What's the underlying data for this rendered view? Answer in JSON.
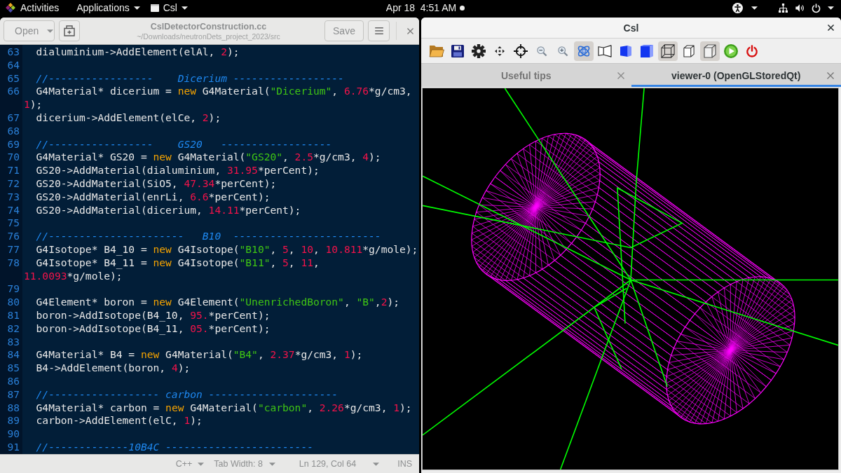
{
  "top_bar": {
    "activities": "Activities",
    "applications": "Applications",
    "app_menu": "Csl",
    "clock": "Apr 18  4:51 AM",
    "notification": true
  },
  "editor": {
    "open_button": "Open",
    "title": "CslDetectorConstruction.cc",
    "subtitle": "~/Downloads/neutronDets_project_2023/src",
    "save_button": "Save",
    "lines": [
      {
        "number": "63",
        "tokens": [
          {
            "kind": "plain",
            "text": "  dialuminium->AddElement(elAl, "
          },
          {
            "kind": "number",
            "text": "2"
          },
          {
            "kind": "plain",
            "text": ");"
          }
        ]
      },
      {
        "number": "64"
      },
      {
        "number": "65",
        "tokens": [
          {
            "kind": "comment",
            "text": "  //-----------------    Dicerium ------------------"
          }
        ]
      },
      {
        "number": "66",
        "tokens": [
          {
            "kind": "plain",
            "text": "  G4Material* dicerium = "
          },
          {
            "kind": "keyword",
            "text": "new"
          },
          {
            "kind": "plain",
            "text": " G4Material("
          },
          {
            "kind": "string",
            "text": "\"Dicerium\""
          },
          {
            "kind": "plain",
            "text": ", "
          },
          {
            "kind": "number",
            "text": "6.76"
          },
          {
            "kind": "plain",
            "text": "*g/cm3, "
          },
          {
            "kind": "number",
            "text": "1"
          },
          {
            "kind": "plain",
            "text": ");"
          }
        ]
      },
      {
        "number": "67",
        "tokens": [
          {
            "kind": "plain",
            "text": "  dicerium->AddElement(elCe, "
          },
          {
            "kind": "number",
            "text": "2"
          },
          {
            "kind": "plain",
            "text": ");"
          }
        ]
      },
      {
        "number": "68"
      },
      {
        "number": "69",
        "tokens": [
          {
            "kind": "comment",
            "text": "  //-----------------    GS20   ------------------"
          }
        ]
      },
      {
        "number": "70",
        "tokens": [
          {
            "kind": "plain",
            "text": "  G4Material* GS20 = "
          },
          {
            "kind": "keyword",
            "text": "new"
          },
          {
            "kind": "plain",
            "text": " G4Material("
          },
          {
            "kind": "string",
            "text": "\"GS20\""
          },
          {
            "kind": "plain",
            "text": ", "
          },
          {
            "kind": "number",
            "text": "2.5"
          },
          {
            "kind": "plain",
            "text": "*g/cm3, "
          },
          {
            "kind": "number",
            "text": "4"
          },
          {
            "kind": "plain",
            "text": ");"
          }
        ]
      },
      {
        "number": "71",
        "tokens": [
          {
            "kind": "plain",
            "text": "  GS20->AddMaterial(dialuminium, "
          },
          {
            "kind": "number",
            "text": "31.95"
          },
          {
            "kind": "plain",
            "text": "*perCent);"
          }
        ]
      },
      {
        "number": "72",
        "tokens": [
          {
            "kind": "plain",
            "text": "  GS20->AddMaterial(SiO5, "
          },
          {
            "kind": "number",
            "text": "47.34"
          },
          {
            "kind": "plain",
            "text": "*perCent);"
          }
        ]
      },
      {
        "number": "73",
        "tokens": [
          {
            "kind": "plain",
            "text": "  GS20->AddMaterial(enrLi, "
          },
          {
            "kind": "number",
            "text": "6.6"
          },
          {
            "kind": "plain",
            "text": "*perCent);"
          }
        ]
      },
      {
        "number": "74",
        "tokens": [
          {
            "kind": "plain",
            "text": "  GS20->AddMaterial(dicerium, "
          },
          {
            "kind": "number",
            "text": "14.11"
          },
          {
            "kind": "plain",
            "text": "*perCent);"
          }
        ]
      },
      {
        "number": "75"
      },
      {
        "number": "76",
        "tokens": [
          {
            "kind": "comment",
            "text": "  //----------------------   B10  ------------------------"
          }
        ]
      },
      {
        "number": "77",
        "tokens": [
          {
            "kind": "plain",
            "text": "  G4Isotope* B4_10 = "
          },
          {
            "kind": "keyword",
            "text": "new"
          },
          {
            "kind": "plain",
            "text": " G4Isotope("
          },
          {
            "kind": "string",
            "text": "\"B10\""
          },
          {
            "kind": "plain",
            "text": ", "
          },
          {
            "kind": "number",
            "text": "5"
          },
          {
            "kind": "plain",
            "text": ", "
          },
          {
            "kind": "number",
            "text": "10"
          },
          {
            "kind": "plain",
            "text": ", "
          },
          {
            "kind": "number",
            "text": "10.811"
          },
          {
            "kind": "plain",
            "text": "*g/mole);"
          }
        ]
      },
      {
        "number": "78",
        "tokens": [
          {
            "kind": "plain",
            "text": "  G4Isotope* B4_11 = "
          },
          {
            "kind": "keyword",
            "text": "new"
          },
          {
            "kind": "plain",
            "text": " G4Isotope("
          },
          {
            "kind": "string",
            "text": "\"B11\""
          },
          {
            "kind": "plain",
            "text": ", "
          },
          {
            "kind": "number",
            "text": "5"
          },
          {
            "kind": "plain",
            "text": ", "
          },
          {
            "kind": "number",
            "text": "11"
          },
          {
            "kind": "plain",
            "text": ", "
          },
          {
            "kind": "number",
            "text": "11.0093"
          },
          {
            "kind": "plain",
            "text": "*g/mole);"
          }
        ]
      },
      {
        "number": "79"
      },
      {
        "number": "80",
        "tokens": [
          {
            "kind": "plain",
            "text": "  G4Element* boron = "
          },
          {
            "kind": "keyword",
            "text": "new"
          },
          {
            "kind": "plain",
            "text": " G4Element("
          },
          {
            "kind": "string",
            "text": "\"UnenrichedBoron\""
          },
          {
            "kind": "plain",
            "text": ", "
          },
          {
            "kind": "string",
            "text": "\"B\""
          },
          {
            "kind": "plain",
            "text": ","
          },
          {
            "kind": "number",
            "text": "2"
          },
          {
            "kind": "plain",
            "text": ");"
          }
        ]
      },
      {
        "number": "81",
        "tokens": [
          {
            "kind": "plain",
            "text": "  boron->AddIsotope(B4_10, "
          },
          {
            "kind": "number",
            "text": "95."
          },
          {
            "kind": "plain",
            "text": "*perCent);"
          }
        ]
      },
      {
        "number": "82",
        "tokens": [
          {
            "kind": "plain",
            "text": "  boron->AddIsotope(B4_11, "
          },
          {
            "kind": "number",
            "text": "05."
          },
          {
            "kind": "plain",
            "text": "*perCent);"
          }
        ]
      },
      {
        "number": "83"
      },
      {
        "number": "84",
        "tokens": [
          {
            "kind": "plain",
            "text": "  G4Material* B4 = "
          },
          {
            "kind": "keyword",
            "text": "new"
          },
          {
            "kind": "plain",
            "text": " G4Material("
          },
          {
            "kind": "string",
            "text": "\"B4\""
          },
          {
            "kind": "plain",
            "text": ", "
          },
          {
            "kind": "number",
            "text": "2.37"
          },
          {
            "kind": "plain",
            "text": "*g/cm3, "
          },
          {
            "kind": "number",
            "text": "1"
          },
          {
            "kind": "plain",
            "text": ");"
          }
        ]
      },
      {
        "number": "85",
        "tokens": [
          {
            "kind": "plain",
            "text": "  B4->AddElement(boron, "
          },
          {
            "kind": "number",
            "text": "4"
          },
          {
            "kind": "plain",
            "text": ");"
          }
        ]
      },
      {
        "number": "86"
      },
      {
        "number": "87",
        "tokens": [
          {
            "kind": "comment",
            "text": "  //------------------ carbon ---------------------"
          }
        ]
      },
      {
        "number": "88",
        "tokens": [
          {
            "kind": "plain",
            "text": "  G4Material* carbon = "
          },
          {
            "kind": "keyword",
            "text": "new"
          },
          {
            "kind": "plain",
            "text": " G4Material("
          },
          {
            "kind": "string",
            "text": "\"carbon\""
          },
          {
            "kind": "plain",
            "text": ", "
          },
          {
            "kind": "number",
            "text": "2.26"
          },
          {
            "kind": "plain",
            "text": "*g/cm3, "
          },
          {
            "kind": "number",
            "text": "1"
          },
          {
            "kind": "plain",
            "text": ");"
          }
        ]
      },
      {
        "number": "89",
        "tokens": [
          {
            "kind": "plain",
            "text": "  carbon->AddElement(elC, "
          },
          {
            "kind": "number",
            "text": "1"
          },
          {
            "kind": "plain",
            "text": ");"
          }
        ]
      },
      {
        "number": "90"
      },
      {
        "number": "91",
        "tokens": [
          {
            "kind": "comment",
            "text": "  //-------------10B4C ------------------------"
          }
        ]
      }
    ],
    "status_bar": {
      "language": "C++",
      "tab_width": "Tab Width: 8",
      "position": "Ln 129, Col 64",
      "mode": "INS"
    }
  },
  "viewer_window": {
    "title": "Csl",
    "toolbar": [
      {
        "kind": "folder",
        "active": false
      },
      {
        "kind": "floppy",
        "active": false
      },
      {
        "kind": "gear",
        "active": false
      },
      {
        "kind": "move",
        "active": false
      },
      {
        "kind": "crosshair",
        "active": false
      },
      {
        "kind": "zoom-out",
        "active": false
      },
      {
        "kind": "zoom-in",
        "active": false
      },
      {
        "kind": "orbit",
        "active": true
      },
      {
        "kind": "frustum",
        "active": false
      },
      {
        "kind": "solid-box",
        "active": false
      },
      {
        "kind": "solid-cube",
        "active": false
      },
      {
        "kind": "wire-cube",
        "active": true
      },
      {
        "kind": "small-cube",
        "active": false
      },
      {
        "kind": "cube",
        "active": true
      },
      {
        "kind": "play",
        "active": false
      },
      {
        "kind": "power",
        "active": false
      }
    ],
    "tabs": [
      {
        "label": "Useful tips",
        "selected": false
      },
      {
        "label": "viewer-0 (OpenGLStoredQt)",
        "selected": true
      }
    ]
  }
}
